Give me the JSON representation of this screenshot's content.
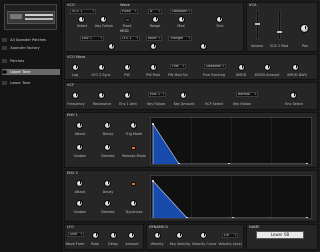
{
  "sidebar": {
    "items": [
      {
        "label": "All Xpander Patches",
        "icon": "folder-icon"
      },
      {
        "label": "Xpander Factory",
        "icon": "folder-icon"
      },
      {
        "label": "Patches",
        "icon": "folder-icon"
      },
      {
        "label": "Upper Tone",
        "icon": "folder-icon",
        "selected": true
      },
      {
        "label": "Lower Tone",
        "icon": "folder-icon"
      }
    ]
  },
  "vco": {
    "title": "VCO",
    "vco_select": "VCO 1",
    "select_label": "Select",
    "key_follow_label": "Key Follow",
    "modes": [
      "Wave",
      "Fixed"
    ],
    "range_label": "Range",
    "range_value": "8'",
    "mod_label": "Mod",
    "pulse_value": "Pulse",
    "fine_label": "Fine",
    "source_values": [
      "Sawtooth",
      "Triangle"
    ],
    "mod_section_title": "MOD",
    "mod_select": "ENV 1",
    "mod_values": [
      "LFO 1",
      "RAMP"
    ]
  },
  "vca": {
    "title": "VCA",
    "labels": [
      "Volume",
      "VCA 2 Mod",
      "Pan"
    ]
  },
  "vco_mods": {
    "title": "VCO Mods",
    "labels": [
      "Lag",
      "LFO 2 Sync",
      "PW",
      "PW Mod",
      "PW Mod Src",
      "Fine Tracking",
      "XMOD",
      "XMOD Amount",
      "XMOD DWV"
    ],
    "select_values": [
      "Fine",
      "Sawtooth"
    ]
  },
  "vcf": {
    "title": "VCF",
    "labels": [
      "Frequency",
      "Resonance",
      "Env 1 Amt",
      "Key Follow",
      "Key Amount",
      "VCF Select",
      "Key Follow",
      "Env Select"
    ],
    "select_values": [
      "ENV 1",
      "Normal"
    ]
  },
  "env1": {
    "title": "ENV 1",
    "labels": [
      "Attack",
      "Decay",
      "Sustain",
      "Release",
      "Trig Mode",
      "Amp",
      "Release Mode"
    ],
    "indicator": "on"
  },
  "env2": {
    "title": "ENV 2",
    "labels": [
      "Attack",
      "Decay",
      "Sustain",
      "Release",
      "Dynamics",
      "Amp"
    ],
    "indicator": "on"
  },
  "lfo": {
    "title": "LFO",
    "select_value": "Sine",
    "labels": [
      "Wave Form",
      "Rate",
      "Delay",
      "Amount"
    ]
  },
  "dynamics": {
    "title": "DYNAMICS",
    "labels": [
      "Velocity",
      "Key Velocity",
      "Velocity Curve",
      "Velocity Level"
    ],
    "select_value": "Lin"
  },
  "patch_name": {
    "title": "NAME",
    "value": "Lower 0B"
  },
  "colors": {
    "accent": "#e07020",
    "envelope_fill": "#1a56c8",
    "background": "#1b1b1b"
  }
}
